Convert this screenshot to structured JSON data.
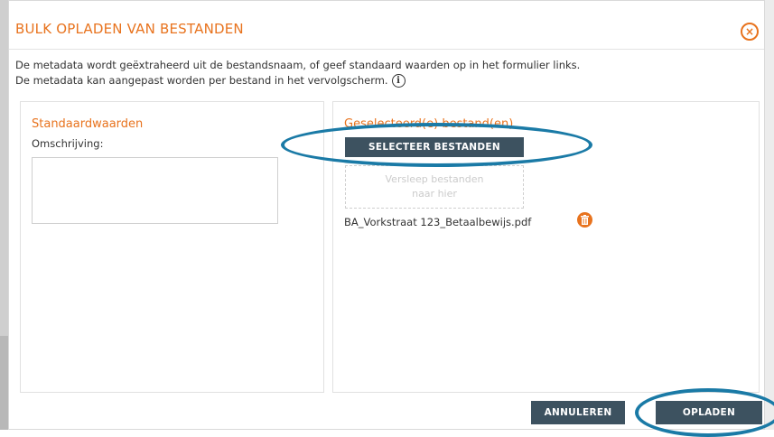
{
  "dialog": {
    "title": "BULK OPLADEN VAN BESTANDEN",
    "close_symbol": "×",
    "intro_line1": "De metadata wordt geëxtraheerd uit de bestandsnaam, of geef standaard waarden op in het formulier links.",
    "intro_line2": "De metadata kan aangepast worden per bestand in het vervolgscherm.",
    "info_symbol": "i"
  },
  "left_panel": {
    "title": "Standaardwaarden",
    "field_label": "Omschrijving:",
    "field_value": ""
  },
  "right_panel": {
    "title": "Geselecteerd(e) bestand(en)",
    "select_button": "SELECTEER BESTANDEN",
    "dropzone_line1": "Versleep bestanden",
    "dropzone_line2": "naar hier",
    "files": [
      {
        "name": "BA_Vorkstraat 123_Betaalbewijs.pdf"
      }
    ]
  },
  "footer": {
    "cancel_label": "ANNULEREN",
    "upload_label": "OPLADEN"
  },
  "icons": {
    "close": "close-icon",
    "info": "info-icon",
    "delete": "trash-icon"
  },
  "colors": {
    "accent": "#e8731e",
    "button": "#3d5260",
    "highlight": "#1a7aa6"
  }
}
